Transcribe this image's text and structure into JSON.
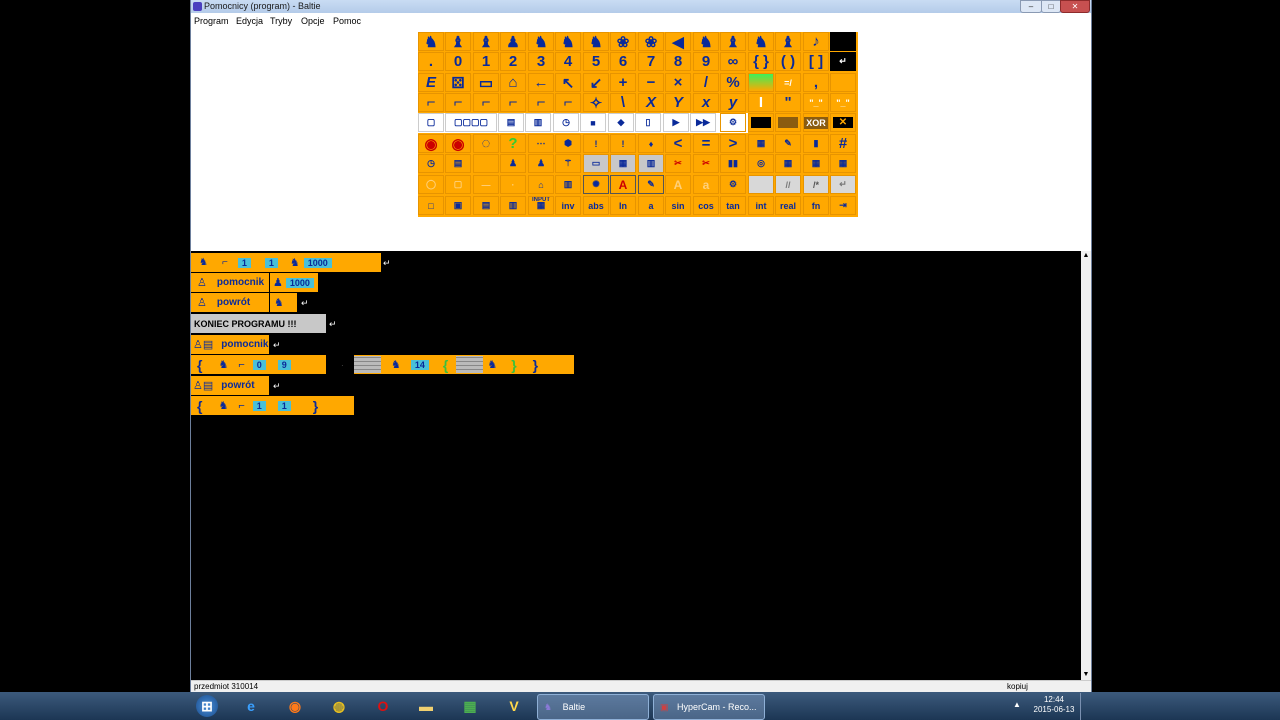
{
  "window": {
    "title": "Pomocnicy (program) - Baltie"
  },
  "window_controls": {
    "minimize": "–",
    "maximize": "□",
    "close": "✕"
  },
  "menu": [
    "Program",
    "Edycja",
    "Tryby",
    "Opcje",
    "Pomoc"
  ],
  "toolbar": {
    "back_label": "«",
    "help_label": "?"
  },
  "palette": {
    "row2": [
      ".",
      "0",
      "1",
      "2",
      "3",
      "4",
      "5",
      "6",
      "7",
      "8",
      "9",
      "∞",
      "{ }",
      "( )",
      "[ ]",
      "↵"
    ],
    "row3": [
      "E",
      "⚄",
      "▭",
      "⌂",
      "←",
      "↖",
      "↙",
      "+",
      "−",
      "×",
      "/",
      "%",
      "",
      "=/",
      ",",
      ""
    ],
    "row4": [
      "⌐",
      "⌐",
      "⌐",
      "⌐",
      "⌐",
      "⌐",
      "✧",
      "\\",
      "X",
      "Y",
      "x",
      "y",
      "I",
      "\"",
      "\"_\"",
      "\"_\""
    ],
    "row9": [
      "□",
      "▣",
      "▤",
      "▥",
      "▦",
      "INPUT",
      "inv",
      "abs",
      "ln",
      "a",
      "sin",
      "cos",
      "tan",
      "int",
      "real",
      "fn"
    ],
    "xor_label": "XOR"
  },
  "program": {
    "line1_number": "1000",
    "line1_vals": [
      "1",
      "1"
    ],
    "line2_label": "pomocnik",
    "line2_num": "1000",
    "line3_label": "powrót",
    "end_label": "KONIEC PROGRAMU !!!",
    "proc1_label": "pomocnik",
    "proc1_body_vals": [
      "0",
      "9"
    ],
    "proc1_count": "14",
    "proc2_label": "powrót",
    "proc2_body_vals": [
      "1",
      "1"
    ]
  },
  "statusbar": {
    "left": "przedmiot 310014",
    "right": "kopiuj"
  },
  "taskbar": {
    "apps": [
      {
        "name": "Baltie",
        "label": "Baltie"
      },
      {
        "name": "HyperCam",
        "label": "HyperCam - Reco..."
      }
    ],
    "clock_time": "12:44",
    "clock_date": "2015-06-13"
  },
  "colors": {
    "tile": "#ffa800",
    "tile_border": "#e79400",
    "number_bg": "#49c0d8",
    "glyph": "#0a2a9a"
  }
}
